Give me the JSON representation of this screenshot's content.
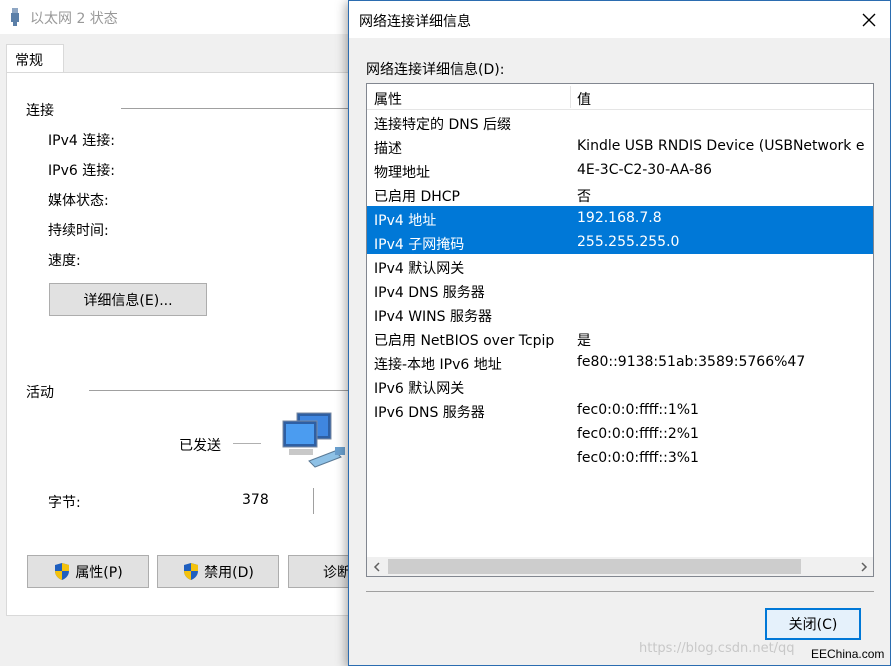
{
  "background_window": {
    "title": "以太网 2 状态",
    "tab": "常规",
    "connection_group": "连接",
    "fields": [
      "IPv4 连接:",
      "IPv6 连接:",
      "媒体状态:",
      "持续时间:",
      "速度:"
    ],
    "details_button": "详细信息(E)...",
    "activity_group": "活动",
    "sent_label": "已发送",
    "bytes_label": "字节:",
    "bytes_sent": "378",
    "properties_button": "属性(P)",
    "disable_button": "禁用(D)",
    "diagnose_button": "诊断"
  },
  "dialog": {
    "title": "网络连接详细信息",
    "list_label": "网络连接详细信息(D):",
    "columns": {
      "property": "属性",
      "value": "值"
    },
    "rows": [
      {
        "property": "连接特定的 DNS 后缀",
        "value": "",
        "selected": false
      },
      {
        "property": "描述",
        "value": "Kindle USB RNDIS Device (USBNetwork e",
        "selected": false
      },
      {
        "property": "物理地址",
        "value": "4E-3C-C2-30-AA-86",
        "selected": false
      },
      {
        "property": "已启用 DHCP",
        "value": "否",
        "selected": false
      },
      {
        "property": "IPv4 地址",
        "value": "192.168.7.8",
        "selected": true
      },
      {
        "property": "IPv4 子网掩码",
        "value": "255.255.255.0",
        "selected": true
      },
      {
        "property": "IPv4 默认网关",
        "value": "",
        "selected": false
      },
      {
        "property": "IPv4 DNS 服务器",
        "value": "",
        "selected": false
      },
      {
        "property": "IPv4 WINS 服务器",
        "value": "",
        "selected": false
      },
      {
        "property": "已启用 NetBIOS over Tcpip",
        "value": "是",
        "selected": false
      },
      {
        "property": "连接-本地 IPv6 地址",
        "value": "fe80::9138:51ab:3589:5766%47",
        "selected": false
      },
      {
        "property": "IPv6 默认网关",
        "value": "",
        "selected": false
      },
      {
        "property": "IPv6 DNS 服务器",
        "value": "fec0:0:0:ffff::1%1",
        "selected": false
      },
      {
        "property": "",
        "value": "fec0:0:0:ffff::2%1",
        "selected": false
      },
      {
        "property": "",
        "value": "fec0:0:0:ffff::3%1",
        "selected": false
      }
    ],
    "close_button": "关闭(C)"
  },
  "watermark": "https://blog.csdn.net/qq",
  "brand": "EEChina.com",
  "colors": {
    "selection": "#0078d7",
    "focus_border": "#0078d7"
  },
  "icons": [
    "ethernet-icon",
    "shield-icon",
    "close-icon",
    "network-computers-icon",
    "chevron-left-icon",
    "chevron-right-icon"
  ]
}
